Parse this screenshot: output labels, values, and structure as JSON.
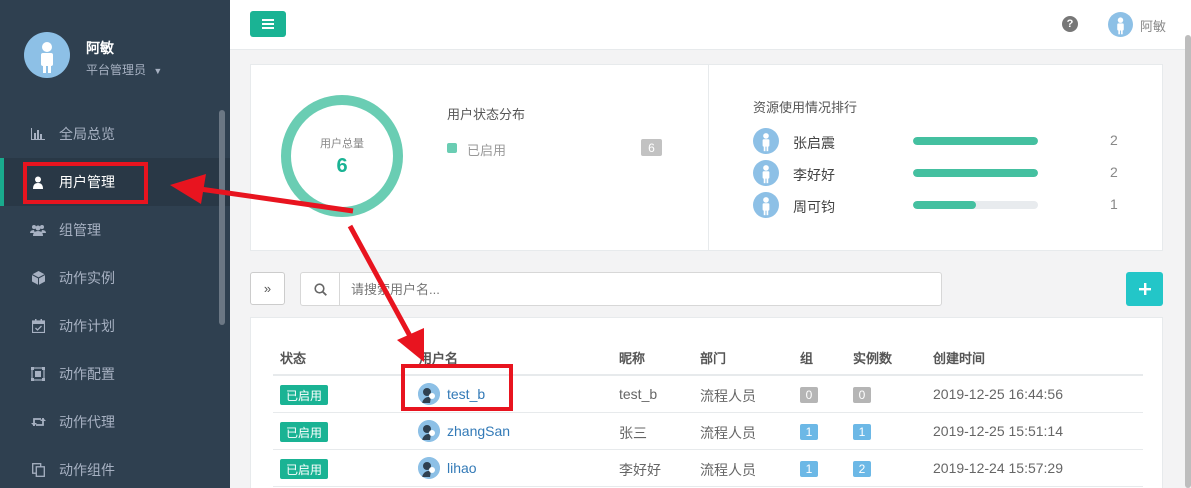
{
  "sidebar": {
    "user_name": "阿敏",
    "user_role": "平台管理员",
    "items": [
      {
        "label": "全局总览",
        "icon": "bar-chart-icon"
      },
      {
        "label": "用户管理",
        "icon": "user-icon",
        "active": true
      },
      {
        "label": "组管理",
        "icon": "users-icon"
      },
      {
        "label": "动作实例",
        "icon": "cube-icon"
      },
      {
        "label": "动作计划",
        "icon": "calendar-icon"
      },
      {
        "label": "动作配置",
        "icon": "config-icon"
      },
      {
        "label": "动作代理",
        "icon": "retweet-icon"
      },
      {
        "label": "动作组件",
        "icon": "copy-icon"
      }
    ]
  },
  "topbar": {
    "user_name": "阿敏"
  },
  "stats": {
    "total_label": "用户总量",
    "total_value": "6",
    "distribution_title": "用户状态分布",
    "distribution_legend": "已启用",
    "distribution_count": "6",
    "ranking_title": "资源使用情况排行",
    "ranking": [
      {
        "name": "张启震",
        "count": "2",
        "fraction": 1.0
      },
      {
        "name": "李好好",
        "count": "2",
        "fraction": 1.0
      },
      {
        "name": "周可钧",
        "count": "1",
        "fraction": 0.5
      }
    ]
  },
  "search": {
    "placeholder": "请搜索用户名..."
  },
  "table": {
    "headers": {
      "status": "状态",
      "username": "用户名",
      "nickname": "昵称",
      "department": "部门",
      "group": "组",
      "instances": "实例数",
      "created": "创建时间"
    },
    "rows": [
      {
        "status": "已启用",
        "username": "test_b",
        "nickname": "test_b",
        "department": "流程人员",
        "group": "0",
        "instances": "0",
        "created": "2019-12-25 16:44:56"
      },
      {
        "status": "已启用",
        "username": "zhangSan",
        "nickname": "张三",
        "department": "流程人员",
        "group": "1",
        "instances": "1",
        "created": "2019-12-25 15:51:14"
      },
      {
        "status": "已启用",
        "username": "lihao",
        "nickname": "李好好",
        "department": "流程人员",
        "group": "1",
        "instances": "2",
        "created": "2019-12-24 15:57:29"
      }
    ]
  },
  "colors": {
    "accent": "#1ab394",
    "sidebar_bg": "#2f4050",
    "annotation": "#e8141f"
  }
}
